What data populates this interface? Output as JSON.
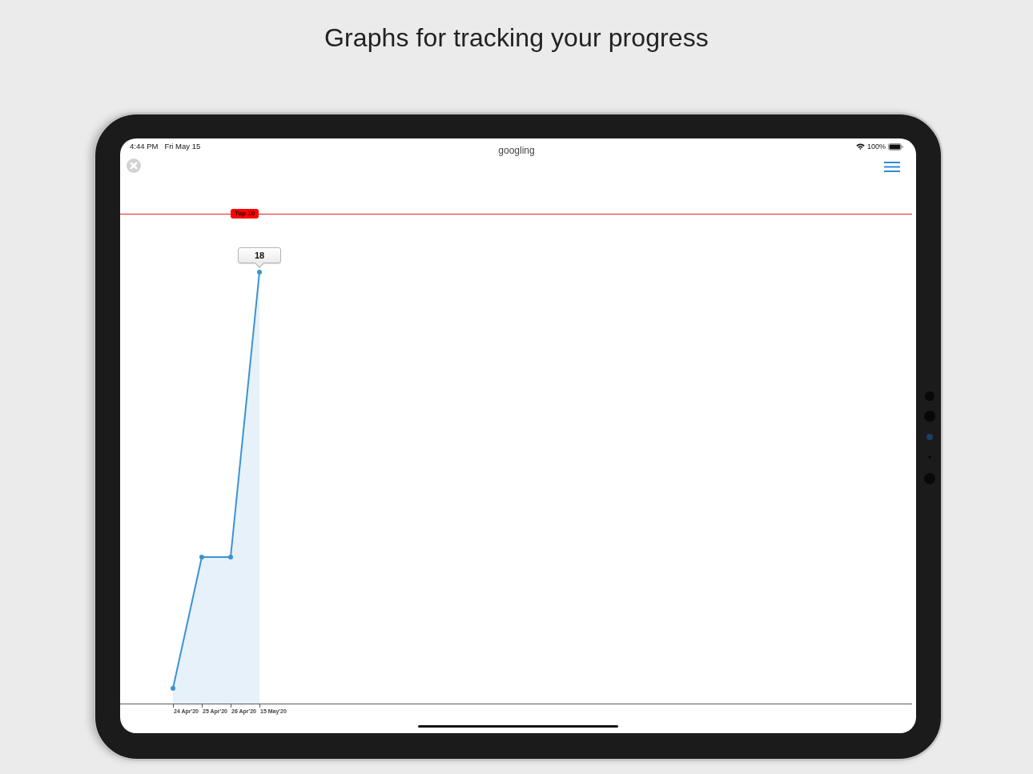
{
  "heading": "Graphs for tracking your progress",
  "status_bar": {
    "time": "4:44 PM",
    "date": "Fri May 15",
    "title": "googling",
    "battery": "100%"
  },
  "chart": {
    "reference_label": "Top 10",
    "tooltip": "18",
    "x_labels": [
      "24 Apr'20",
      "25 Apr'20",
      "26 Apr'20",
      "15 May'20"
    ]
  }
}
